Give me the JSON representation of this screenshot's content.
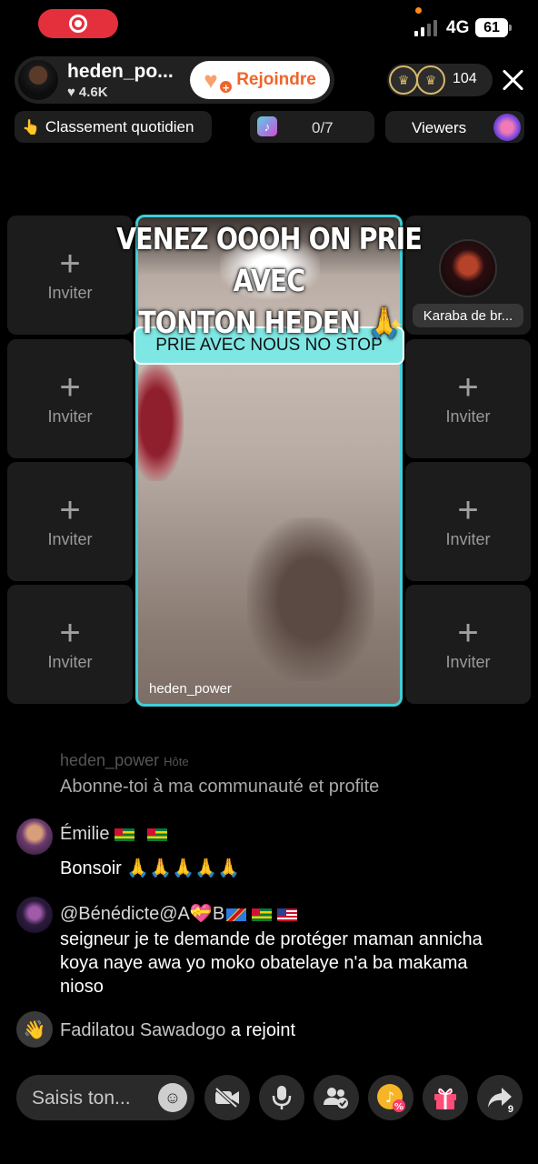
{
  "status_bar": {
    "network": "4G",
    "battery": "61"
  },
  "host": {
    "name": "heden_po...",
    "likes": "4.6K",
    "join_label": "Rejoindre"
  },
  "viewers": {
    "count": "104",
    "label": "Viewers"
  },
  "info_row": {
    "ranking": "Classement quotidien",
    "goal_progress": "0/7"
  },
  "grid": {
    "invite_label": "Inviter",
    "guest_name": "Karaba de br..."
  },
  "main_video": {
    "caption_line1": "VENEZ OOOH ON PRIE AVEC",
    "caption_line2": "TONTON HEDEN 🙏",
    "sticker": "PRIE AVEC NOUS NO STOP",
    "username": "heden_power"
  },
  "chat": {
    "ghost_name": "heden_power",
    "ghost_tag": "Hôte",
    "ghost_text": "Abonne-toi à ma communauté et profite",
    "messages": [
      {
        "name": "Émilie",
        "text": "Bonsoir 🙏🙏🙏🙏🙏"
      },
      {
        "name_prefix": "@Bénédicte@A",
        "name_mid": "B",
        "text": "seigneur je te demande de protéger maman annicha koya naye awa yo moko obatelaye n'a ba makama nioso"
      }
    ],
    "join_notice": {
      "name": "Fadilatou Sawadogo",
      "action": "a rejoint"
    }
  },
  "bottom_bar": {
    "input_placeholder": "Saisis ton...",
    "share_count": "9"
  },
  "colors": {
    "accent_cyan": "#40cfd8",
    "join_orange": "#f0642a",
    "record_red": "#e3303c"
  }
}
